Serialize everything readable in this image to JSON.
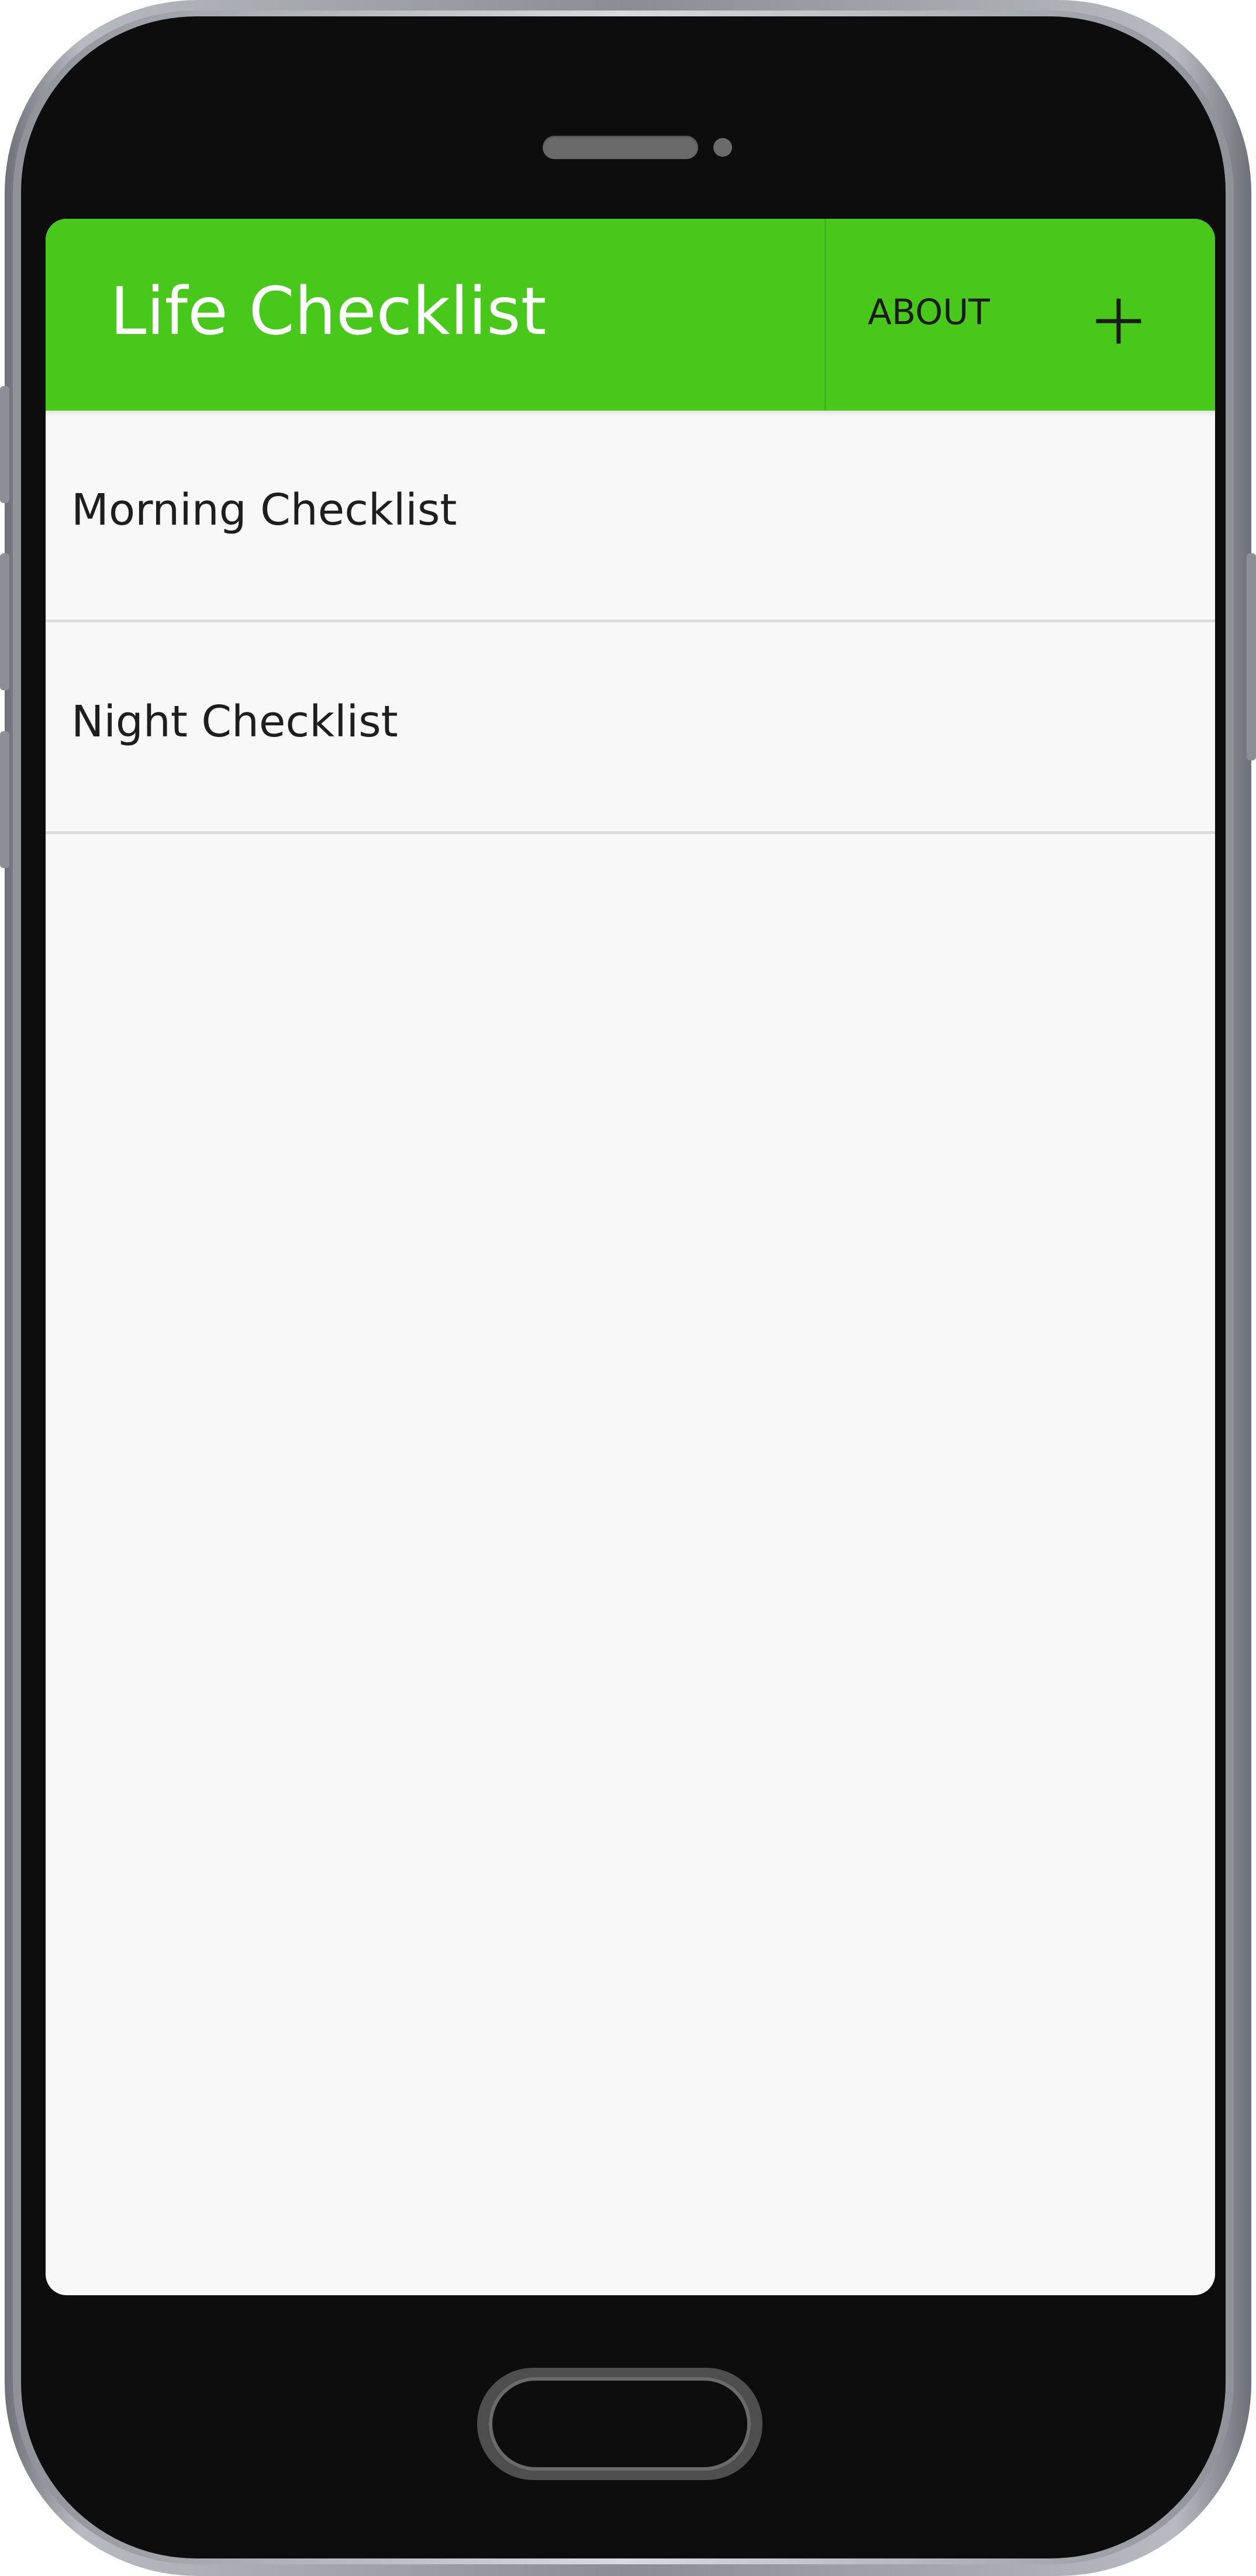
{
  "app_bar": {
    "title": "Life Checklist",
    "about_label": "ABOUT",
    "add_icon": "plus-icon",
    "accent_color": "#48c81a"
  },
  "checklists": [
    {
      "label": "Morning Checklist"
    },
    {
      "label": "Night Checklist"
    }
  ],
  "colors": {
    "screen_background": "#f8f8f8",
    "divider": "#dcdcdc",
    "phone_body": "#0d0d0d"
  }
}
